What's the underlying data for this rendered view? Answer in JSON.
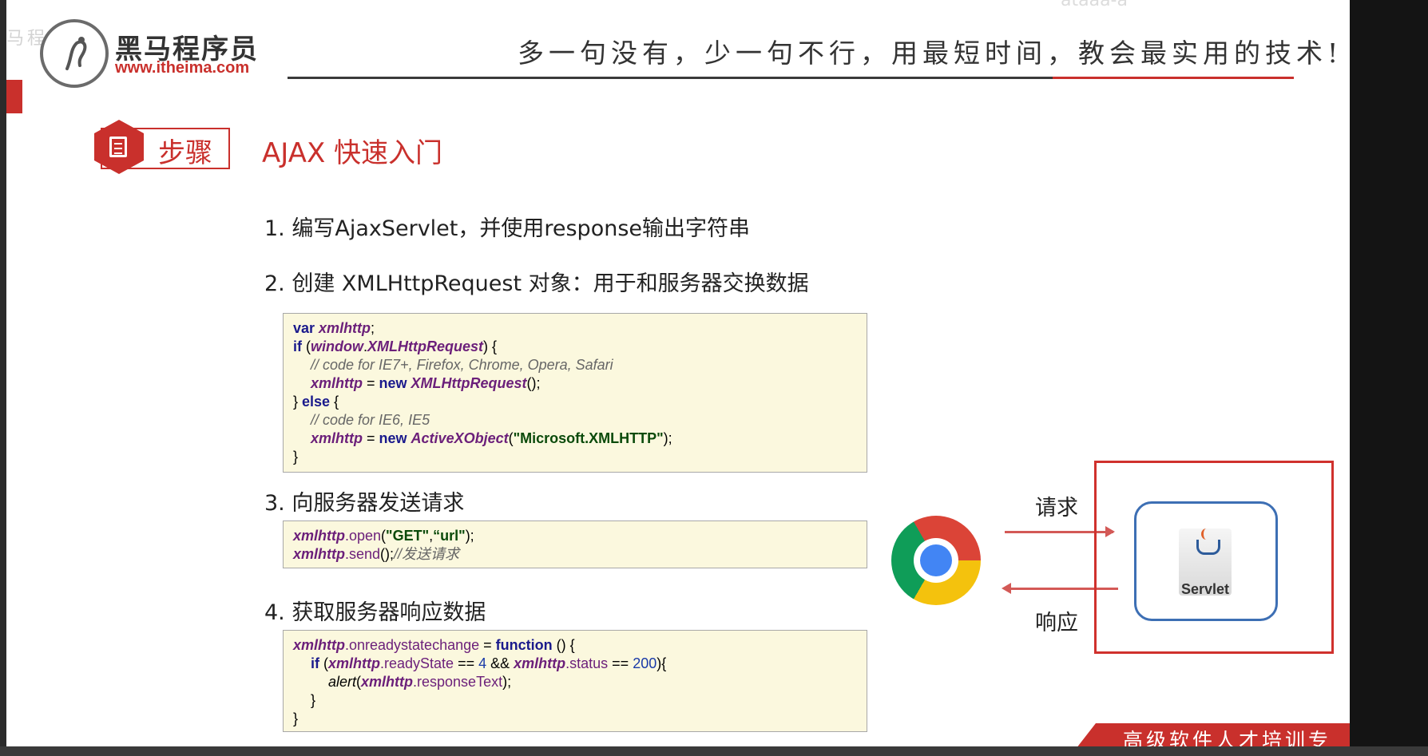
{
  "header": {
    "brand_cn": "黑马程序员",
    "brand_url": "www.itheima.com",
    "watermark": "马程序员",
    "slogan": "多一句没有，少一句不行，用最短时间，教会最实用的技术!",
    "top_faint": "ataaa-a"
  },
  "slide": {
    "step_label": "步骤",
    "title": "AJAX 快速入门"
  },
  "steps": {
    "s1": "1. 编写AjaxServlet，并使用response输出字符串",
    "s2": "2. 创建 XMLHttpRequest 对象：用于和服务器交换数据",
    "s3": "3. 向服务器发送请求",
    "s4": "4. 获取服务器响应数据"
  },
  "code1": {
    "l1_kw": "var",
    "l1_var": "xmlhttp",
    "l1_end": ";",
    "l2_kw": "if",
    "l2_open": " (",
    "l2_a": "window",
    "l2_dot": ".",
    "l2_b": "XMLHttpRequest",
    "l2_close": ") {",
    "l3_cmt": "// code for IE7+, Firefox, Chrome, Opera, Safari",
    "l4_var": "xmlhttp",
    "l4_eq": " = ",
    "l4_kw": "new",
    "l4_cls": "XMLHttpRequest",
    "l4_end": "();",
    "l5_brace": "} ",
    "l5_kw": "else",
    "l5_open": " {",
    "l6_cmt": "// code for IE6, IE5",
    "l7_var": "xmlhttp",
    "l7_eq": " = ",
    "l7_kw": "new",
    "l7_cls": "ActiveXObject",
    "l7_p1": "(",
    "l7_str": "\"Microsoft.XMLHTTP\"",
    "l7_end": ");",
    "l8": "}"
  },
  "code2": {
    "l1_var": "xmlhttp",
    "l1_mth": ".open",
    "l1_p": "(",
    "l1_s1": "\"GET\"",
    "l1_comma": ",",
    "l1_s2": "“url\"",
    "l1_end": ");",
    "l2_var": "xmlhttp",
    "l2_mth": ".send",
    "l2_end": "();",
    "l2_cmt": "//发送请求"
  },
  "code3": {
    "l1_var": "xmlhttp",
    "l1_prop": ".onreadystatechange",
    "l1_eq": " = ",
    "l1_kw": "function",
    "l1_end": " () {",
    "l2_kw": "if",
    "l2_p": " (",
    "l2_var1": "xmlhttp",
    "l2_prop1": ".readyState",
    "l2_op1": " == ",
    "l2_n1": "4",
    "l2_and": " && ",
    "l2_var2": "xmlhttp",
    "l2_prop2": ".status",
    "l2_op2": " == ",
    "l2_n2": "200",
    "l2_end": "){",
    "l3_fn": "alert",
    "l3_p": "(",
    "l3_var": "xmlhttp",
    "l3_prop": ".responseText",
    "l3_end": ");",
    "l4": "}",
    "l5": "}"
  },
  "diagram": {
    "request": "请求",
    "response": "响应",
    "servlet": "Servlet",
    "browser_icon": "chrome-icon",
    "server_icon": "java-icon"
  },
  "footer": {
    "text": "高级软件人才培训专家"
  },
  "colors": {
    "accent": "#c9302c",
    "servlet_border": "#3d6fb4",
    "code_bg": "#fbf8de"
  }
}
